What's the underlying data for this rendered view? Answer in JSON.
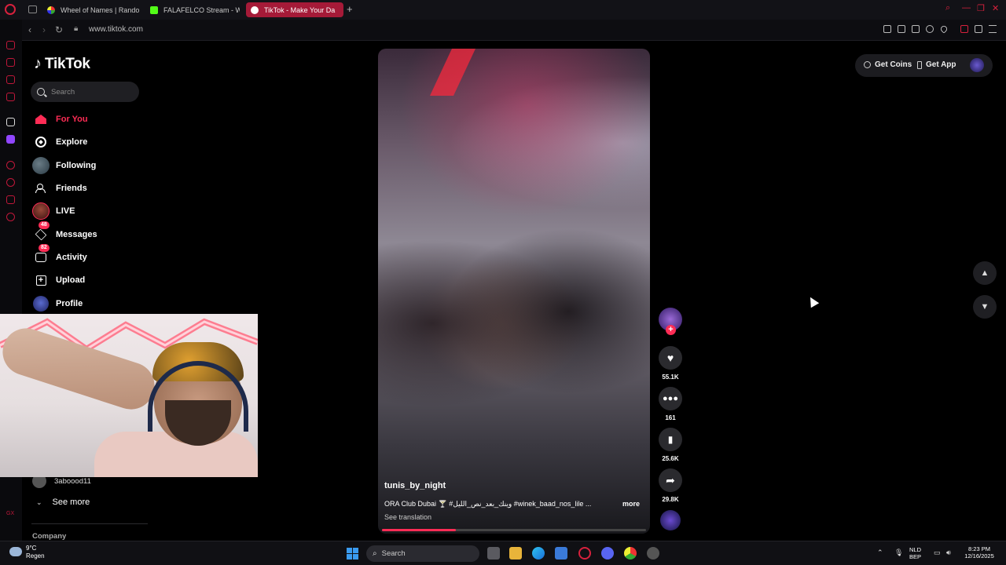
{
  "browser": {
    "tabs": [
      {
        "label": "Wheel of Names | Rando",
        "active": false
      },
      {
        "label": "FALAFELCO Stream - Wa",
        "active": false
      },
      {
        "label": "TikTok - Make Your Da",
        "active": true
      }
    ],
    "new_tab_label": "+",
    "url": "www.tiktok.com",
    "accent_color": "#d8213d"
  },
  "tiktok": {
    "logo_text": "TikTok",
    "search_placeholder": "Search",
    "nav": [
      {
        "label": "For You",
        "icon": "home-icon",
        "active": true
      },
      {
        "label": "Explore",
        "icon": "compass-icon",
        "active": false
      },
      {
        "label": "Following",
        "icon": "following-avatar-icon",
        "active": false
      },
      {
        "label": "Friends",
        "icon": "friends-icon",
        "active": false
      },
      {
        "label": "LIVE",
        "icon": "live-icon",
        "active": false
      },
      {
        "label": "Messages",
        "icon": "messages-icon",
        "badge": "48",
        "active": false
      },
      {
        "label": "Activity",
        "icon": "activity-icon",
        "badge": "82",
        "active": false
      },
      {
        "label": "Upload",
        "icon": "upload-icon",
        "active": false
      },
      {
        "label": "Profile",
        "icon": "profile-icon",
        "active": false
      }
    ],
    "following_account": "3aboood11",
    "see_more_label": "See more",
    "company_label": "Company",
    "brand_color": "#fe2c55",
    "get_coins_label": "Get Coins",
    "get_app_label": "Get App"
  },
  "video": {
    "author": "tunis_by_night",
    "description": "ORA Club Dubai 🍸 #وينك_بعد_نص_الليل #winek_baad_nos_lile ...",
    "more_label": "more",
    "see_translation": "See translation",
    "progress": 0.28,
    "likes": "55.1K",
    "comments": "161",
    "saves": "25.6K",
    "shares": "29.8K"
  },
  "taskbar": {
    "weather_temp": "9°C",
    "weather_desc": "Regen",
    "search_placeholder": "Search",
    "lang_1": "NLD",
    "lang_2": "BEP",
    "time": "8:23 PM",
    "date": "12/16/2025"
  }
}
